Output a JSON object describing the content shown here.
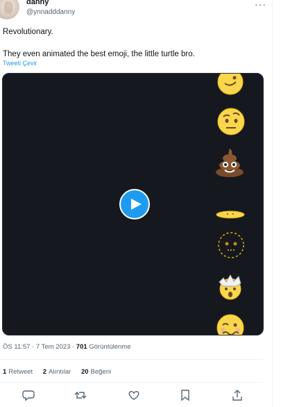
{
  "user": {
    "name": "danny",
    "handle": "@ynnadddanny"
  },
  "tweet": {
    "text": "Revolutionary.\n\nThey even animated the best emoji, the little turtle bro.",
    "translate_label": "Tweeti Çevir"
  },
  "meta": {
    "time": "ÖS 11:57 · 7 Tem 2023 · ",
    "views": "701",
    "views_label": " Görüntülenme"
  },
  "stats": {
    "retweets": "1",
    "retweets_label": "Retweet",
    "quotes": "2",
    "quotes_label": "Alıntılar",
    "likes": "20",
    "likes_label": "Beğeni"
  },
  "icons": [
    "more-icon",
    "play-icon",
    "reply-icon",
    "retweet-icon",
    "like-icon",
    "bookmark-icon",
    "share-icon"
  ],
  "colors": {
    "accent": "#1d9bf0",
    "media_bg": "#16181f",
    "secondary_text": "#536471"
  }
}
